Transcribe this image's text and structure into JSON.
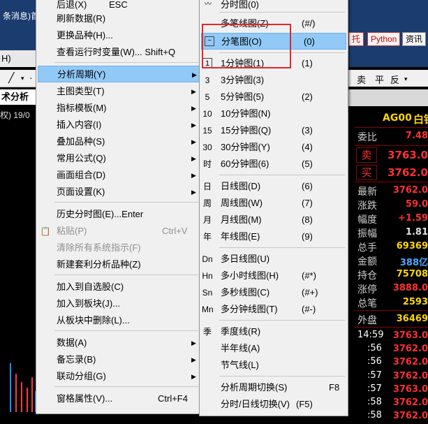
{
  "background": {
    "news_text": "条消息)首",
    "left_letter": "H)",
    "tab_label": "术分析",
    "chart_info": "权) 19/0",
    "right_buttons": [
      "托",
      "Python",
      "资讯"
    ],
    "right_toolbar_icons": [
      "卖",
      "平",
      "反"
    ],
    "quote": {
      "symbol": "AG00",
      "name": "白银",
      "rows": [
        {
          "label": "委比",
          "value": "7.48"
        },
        {
          "label": "卖",
          "value": "3763.0"
        },
        {
          "label": "买",
          "value": "3762.0"
        },
        {
          "label": "最新",
          "value": "3762.0"
        },
        {
          "label": "涨跌",
          "value": "59.0"
        },
        {
          "label": "幅度",
          "value": "+1.59"
        },
        {
          "label": "振幅",
          "value": "1.81"
        },
        {
          "label": "总手",
          "value": "69369"
        },
        {
          "label": "金额",
          "value": "388亿"
        },
        {
          "label": "持仓",
          "value": "75708"
        },
        {
          "label": "涨停",
          "value": "3888.0"
        },
        {
          "label": "总笔",
          "value": "2593"
        },
        {
          "label": "外盘",
          "value": "36469"
        }
      ],
      "ticks": [
        {
          "time": "14:59",
          "price": "3763.0"
        },
        {
          "time": ":56",
          "price": "3762.0"
        },
        {
          "time": ":56",
          "price": "3762.0"
        },
        {
          "time": ":57",
          "price": "3762.0"
        },
        {
          "time": ":57",
          "price": "3763.0"
        },
        {
          "time": ":58",
          "price": "3762.0"
        },
        {
          "time": ":58",
          "price": "3762.0"
        }
      ]
    }
  },
  "main_menu": {
    "items": [
      {
        "label": "后退(X)",
        "shortcut": "ESC"
      },
      {
        "label": "刷新数据(R)"
      },
      {
        "label": "更换品种(H)..."
      },
      {
        "label": "查看运行时变量(W)... Shift+Q"
      },
      {
        "label": "分析周期(Y)"
      },
      {
        "label": "主图类型(T)"
      },
      {
        "label": "指标模板(M)"
      },
      {
        "label": "插入内容(I)"
      },
      {
        "label": "叠加品种(S)"
      },
      {
        "label": "常用公式(Q)"
      },
      {
        "label": "画面组合(D)"
      },
      {
        "label": "页面设置(K)"
      },
      {
        "label": "历史分时图(E)...Enter"
      },
      {
        "label": "粘贴(P)",
        "shortcut": "Ctrl+V"
      },
      {
        "label": "清除所有系统指示(F)"
      },
      {
        "label": "新建套利分析品种(Z)"
      },
      {
        "label": "加入到自选股(C)"
      },
      {
        "label": "加入到板块(J)..."
      },
      {
        "label": "从板块中删除(L)..."
      },
      {
        "label": "数据(A)"
      },
      {
        "label": "备忘录(B)"
      },
      {
        "label": "联动分组(G)"
      },
      {
        "label": "窗格属性(V)...",
        "shortcut": "Ctrl+F4"
      }
    ]
  },
  "sub_menu": {
    "items": [
      {
        "icon": "分时",
        "label": "分时图(0)",
        "shortcut": ""
      },
      {
        "icon": "",
        "label": "多笔线图(Z)",
        "shortcut": "(#/)"
      },
      {
        "icon": "",
        "label": "分笔图(O)",
        "shortcut": "(0)"
      },
      {
        "icon": "1",
        "label": "1分钟图(1)",
        "shortcut": "(1)"
      },
      {
        "icon": "3",
        "label": "3分钟图(3)",
        "shortcut": ""
      },
      {
        "icon": "5",
        "label": "5分钟图(5)",
        "shortcut": "(2)"
      },
      {
        "icon": "10",
        "label": "10分钟图(N)",
        "shortcut": ""
      },
      {
        "icon": "15",
        "label": "15分钟图(Q)",
        "shortcut": "(3)"
      },
      {
        "icon": "30",
        "label": "30分钟图(Y)",
        "shortcut": "(4)"
      },
      {
        "icon": "时",
        "label": "60分钟图(6)",
        "shortcut": "(5)"
      },
      {
        "icon": "日",
        "label": "日线图(D)",
        "shortcut": "(6)"
      },
      {
        "icon": "周",
        "label": "周线图(W)",
        "shortcut": "(7)"
      },
      {
        "icon": "月",
        "label": "月线图(M)",
        "shortcut": "(8)"
      },
      {
        "icon": "年",
        "label": "年线图(E)",
        "shortcut": "(9)"
      },
      {
        "icon": "Dn",
        "label": "多日线图(U)",
        "shortcut": ""
      },
      {
        "icon": "Hn",
        "label": "多小时线图(H)",
        "shortcut": "(#*)"
      },
      {
        "icon": "Sn",
        "label": "多秒线图(C)",
        "shortcut": "(#+)"
      },
      {
        "icon": "Mn",
        "label": "多分钟线图(T)",
        "shortcut": "(#-)"
      },
      {
        "icon": "季",
        "label": "季度线(R)",
        "shortcut": ""
      },
      {
        "icon": "",
        "label": "半年线(A)",
        "shortcut": ""
      },
      {
        "icon": "",
        "label": "节气线(L)",
        "shortcut": ""
      },
      {
        "icon": "",
        "label": "分析周期切换(S)",
        "shortcut": "F8"
      },
      {
        "icon": "",
        "label": "分时/日线切换(V)",
        "shortcut": "(F5)"
      }
    ]
  }
}
